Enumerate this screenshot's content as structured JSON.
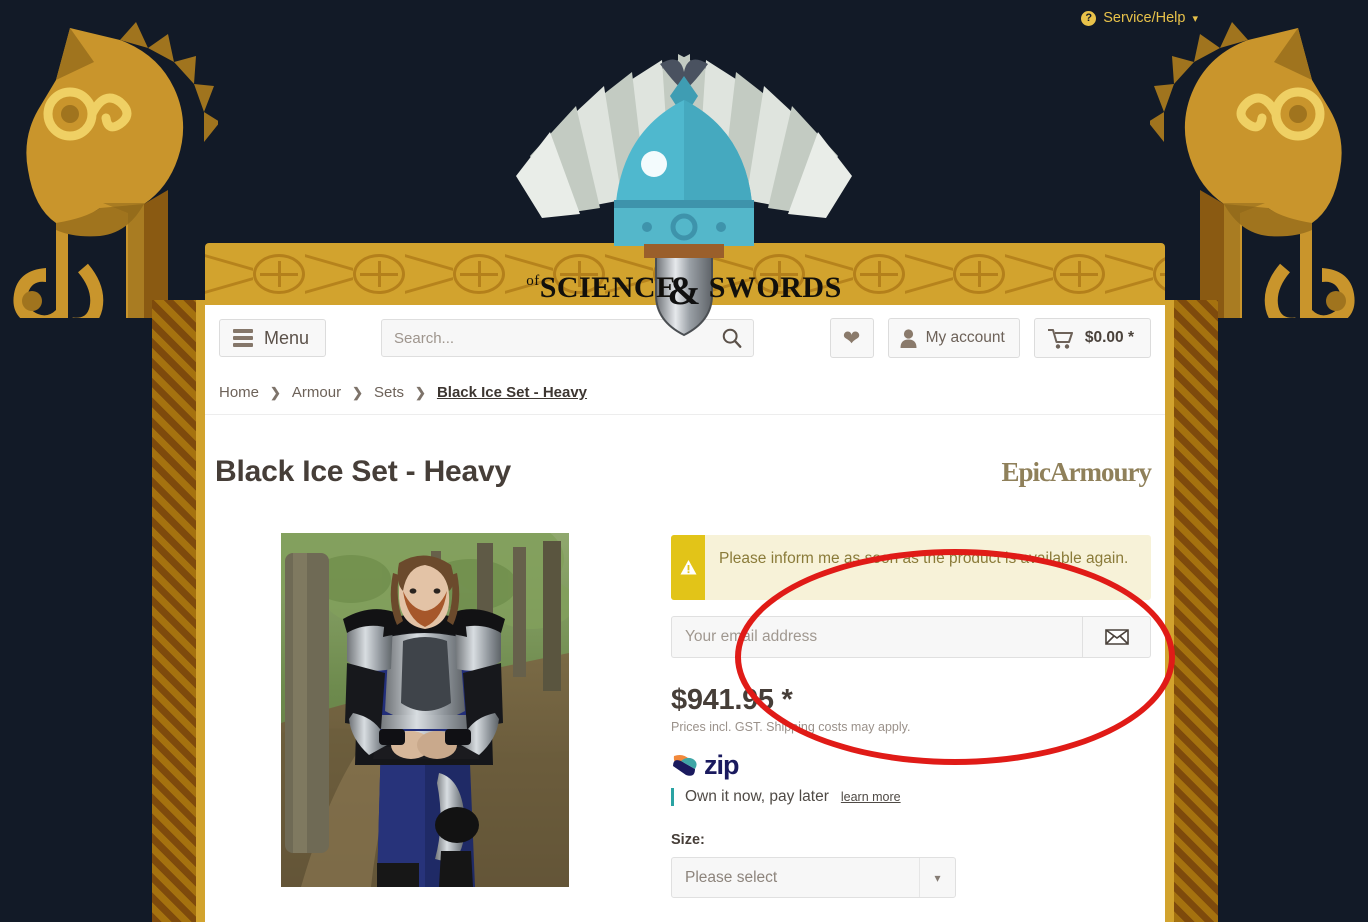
{
  "topbar": {
    "service_help": "Service/Help",
    "help_icon": "question-circle-icon",
    "chevron": "⌄"
  },
  "logo": {
    "of": "of",
    "word1": "SCIENCE",
    "amp": "&",
    "word2": "SWORDS",
    "icon": "winged-helmet-icon"
  },
  "nav": {
    "menu_label": "Menu",
    "menu_icon": "hamburger-icon",
    "search_placeholder": "Search...",
    "search_value": "",
    "search_icon": "magnifier-icon",
    "wishlist_icon": "heart-icon",
    "account_label": "My account",
    "account_icon": "user-icon",
    "cart_amount": "$0.00 *",
    "cart_icon": "shopping-cart-icon"
  },
  "breadcrumb": {
    "separator": "❯",
    "items": [
      {
        "label": "Home",
        "active": false
      },
      {
        "label": "Armour",
        "active": false
      },
      {
        "label": "Sets",
        "active": false
      },
      {
        "label": "Black Ice Set - Heavy",
        "active": true
      }
    ]
  },
  "product": {
    "title": "Black Ice Set - Heavy",
    "brand": "EpicArmoury",
    "image_alt": "Man wearing black and silver plate armour set with blue tabard standing in a forest"
  },
  "notify": {
    "alert_icon": "warning-triangle-icon",
    "alert_text": "Please inform me as soon as the product is available again.",
    "email_placeholder": "Your email address",
    "email_value": "",
    "submit_icon": "envelope-icon"
  },
  "pricing": {
    "price": "$941.95 *",
    "note": "Prices incl. GST. Shipping costs may apply."
  },
  "zip": {
    "brand": "zip",
    "brand_icon": "zip-bolt-icon",
    "tagline": "Own it now, pay later",
    "learn_more": "learn more"
  },
  "size": {
    "label": "Size:",
    "selected": "Please select",
    "chevron_icon": "chevron-down-icon"
  },
  "annotation": {
    "shape": "red-ellipse-highlight"
  },
  "colors": {
    "page_background": "#121a27",
    "gold": "#d2a32e",
    "lattice_dark": "#7e4a0c",
    "lattice_light": "#a5720f",
    "alert_bg": "#f7f2d8",
    "alert_accent": "#e2c418",
    "annotation_red": "#e01b17",
    "zip_navy": "#1a1a5e",
    "zip_teal": "#2aa3a3",
    "helmet_blue": "#4fb8ce"
  }
}
